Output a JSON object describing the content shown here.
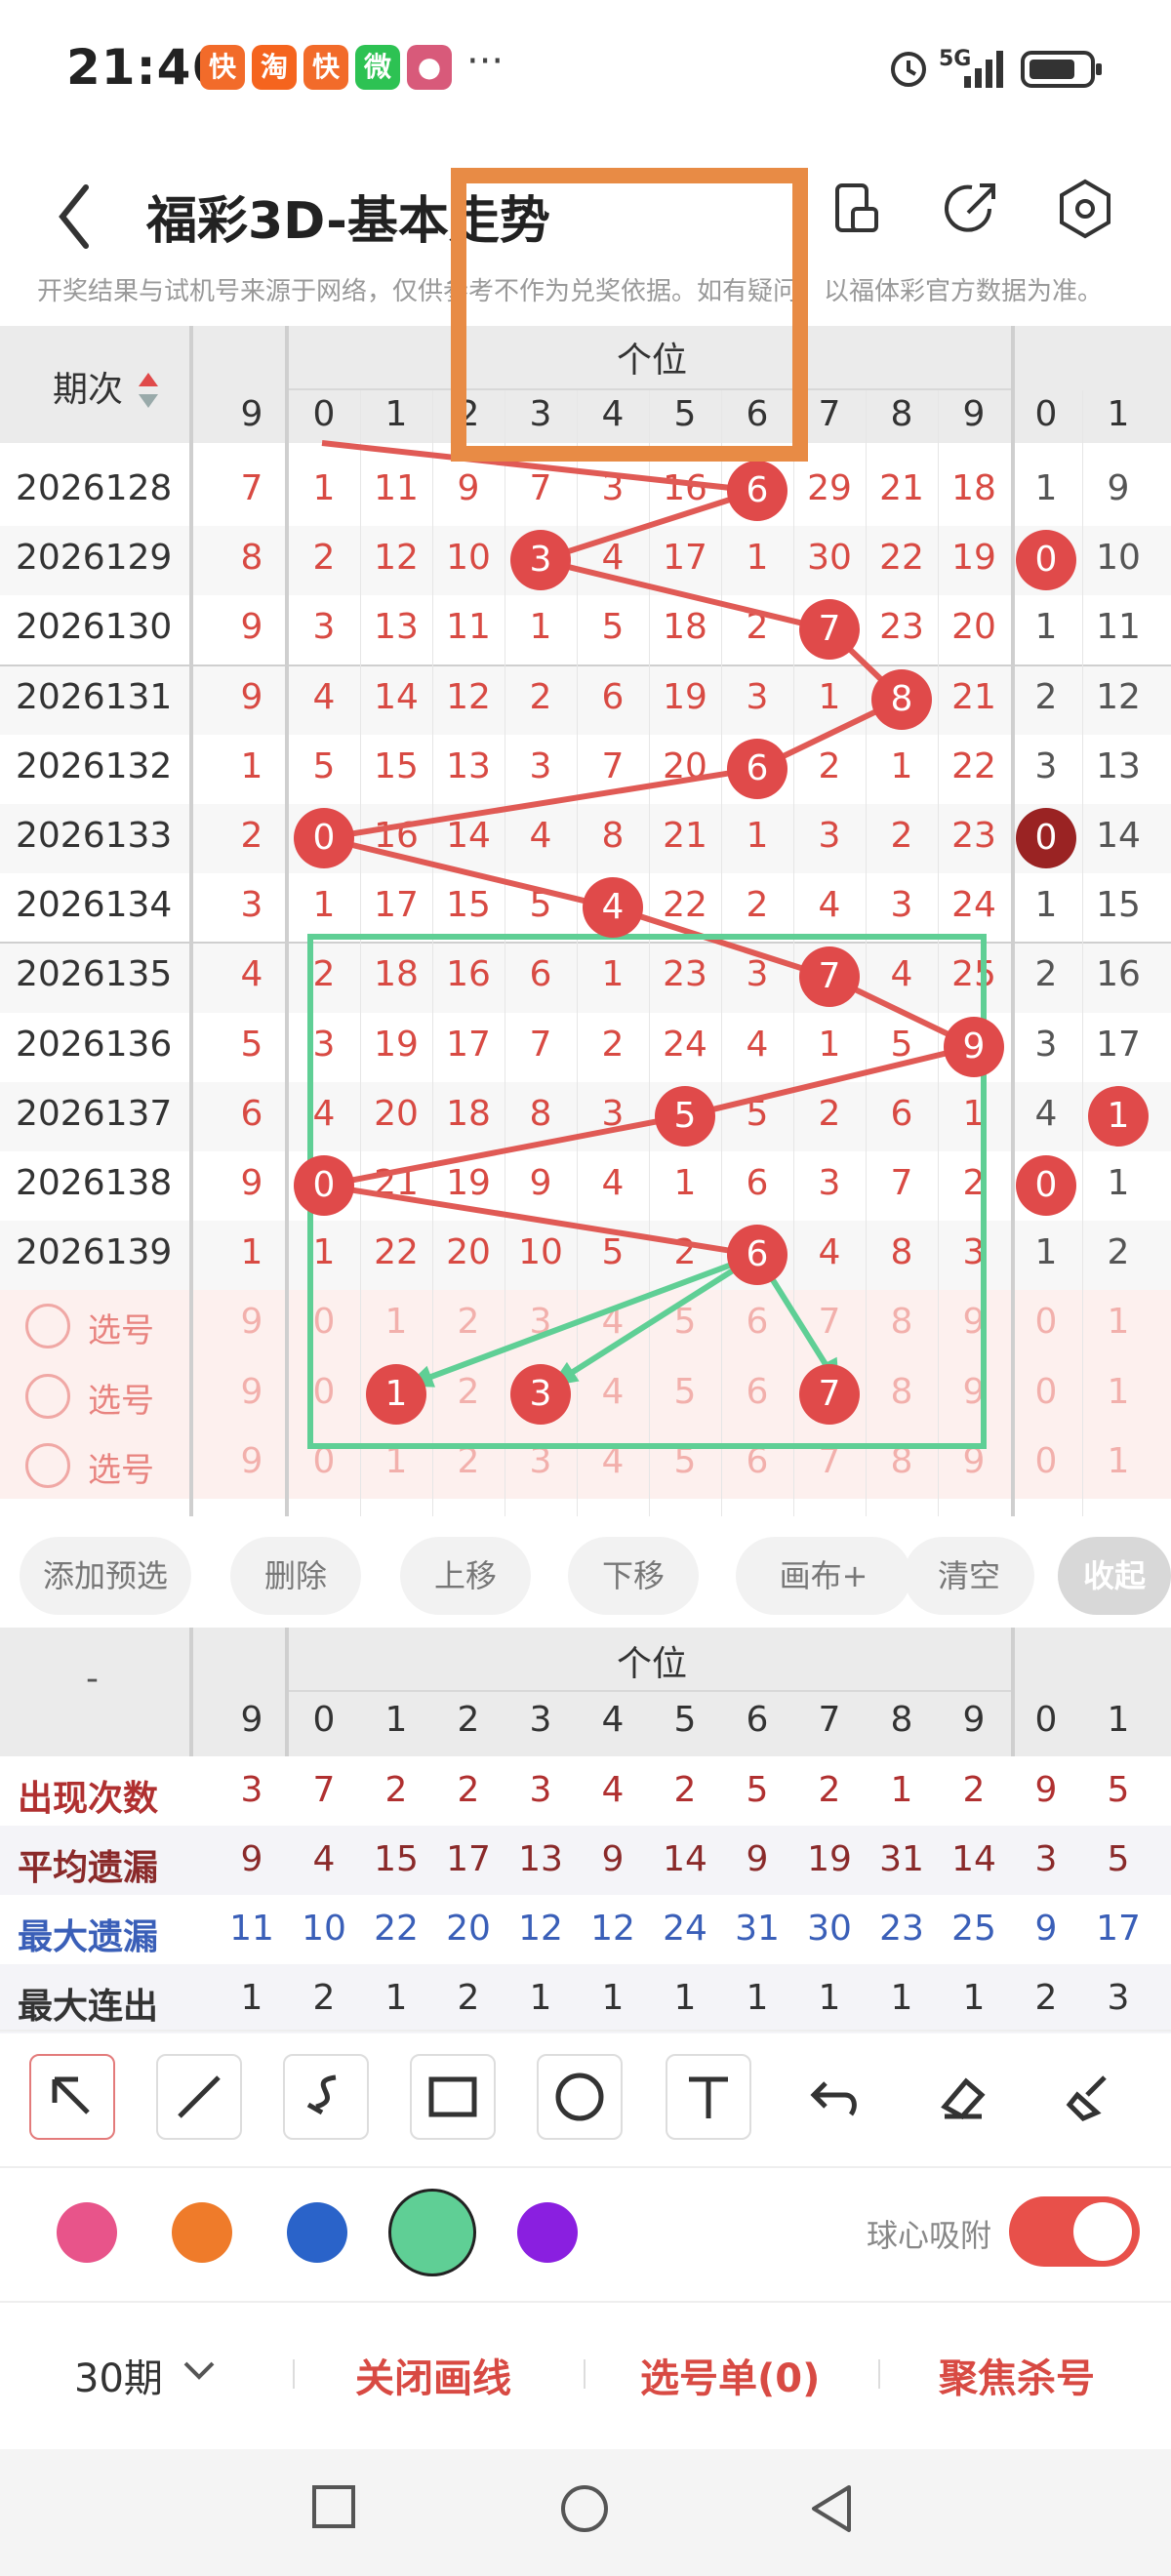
{
  "status_bar": {
    "time": "21:46",
    "apps": [
      {
        "icon": "kuaishou-icon",
        "color": "#f26b2a",
        "glyph": "快"
      },
      {
        "icon": "taobao-icon",
        "color": "#f5641e",
        "glyph": "淘"
      },
      {
        "icon": "kuaishou-icon-2",
        "color": "#f26b2a",
        "glyph": "快"
      },
      {
        "icon": "wechat-icon",
        "color": "#2dc253",
        "glyph": "微"
      },
      {
        "icon": "game-app-icon",
        "color": "#d85a7a",
        "glyph": "●"
      }
    ],
    "more": "···",
    "network": "5G"
  },
  "header": {
    "title": "福彩3D-基本走势",
    "notice": "开奖结果与试机号来源于网络，仅供参考不作为兑奖依据。如有疑问，以福体彩官方数据为准。"
  },
  "trend_table": {
    "period_header": "期次",
    "group_label": "个位",
    "columns": [
      "9",
      "0",
      "1",
      "2",
      "3",
      "4",
      "5",
      "6",
      "7",
      "8",
      "9",
      "0",
      "1"
    ],
    "rows": [
      {
        "period": "2026128",
        "cells": [
          "7",
          "1",
          "11",
          "9",
          "7",
          "3",
          "16",
          "6",
          "29",
          "21",
          "18",
          "1",
          "9"
        ],
        "ball_index": 7
      },
      {
        "period": "2026129",
        "cells": [
          "8",
          "2",
          "12",
          "10",
          "3",
          "4",
          "17",
          "1",
          "30",
          "22",
          "19",
          "0",
          "10"
        ],
        "ball_index": 4
      },
      {
        "period": "2026130",
        "cells": [
          "9",
          "3",
          "13",
          "11",
          "1",
          "5",
          "18",
          "2",
          "7",
          "23",
          "20",
          "1",
          "11"
        ],
        "ball_index": 8
      },
      {
        "period": "2026131",
        "cells": [
          "9",
          "4",
          "14",
          "12",
          "2",
          "6",
          "19",
          "3",
          "1",
          "8",
          "21",
          "2",
          "12"
        ],
        "ball_index": 9
      },
      {
        "period": "2026132",
        "cells": [
          "1",
          "5",
          "15",
          "13",
          "3",
          "7",
          "20",
          "6",
          "2",
          "1",
          "22",
          "3",
          "13"
        ],
        "ball_index": 7
      },
      {
        "period": "2026133",
        "cells": [
          "2",
          "0",
          "16",
          "14",
          "4",
          "8",
          "21",
          "1",
          "3",
          "2",
          "23",
          "0",
          "14"
        ],
        "ball_index": 1
      },
      {
        "period": "2026134",
        "cells": [
          "3",
          "1",
          "17",
          "15",
          "5",
          "4",
          "22",
          "2",
          "4",
          "3",
          "24",
          "1",
          "15"
        ],
        "ball_index": 5
      },
      {
        "period": "2026135",
        "cells": [
          "4",
          "2",
          "18",
          "16",
          "6",
          "1",
          "23",
          "3",
          "7",
          "4",
          "25",
          "2",
          "16"
        ],
        "ball_index": 8
      },
      {
        "period": "2026136",
        "cells": [
          "5",
          "3",
          "19",
          "17",
          "7",
          "2",
          "24",
          "4",
          "1",
          "5",
          "9",
          "3",
          "17"
        ],
        "ball_index": 10
      },
      {
        "period": "2026137",
        "cells": [
          "6",
          "4",
          "20",
          "18",
          "8",
          "3",
          "5",
          "5",
          "2",
          "6",
          "1",
          "4",
          "1"
        ],
        "ball_index": 6
      },
      {
        "period": "2026138",
        "cells": [
          "9",
          "0",
          "21",
          "19",
          "9",
          "4",
          "1",
          "6",
          "3",
          "7",
          "2",
          "0",
          "1"
        ],
        "ball_index": 1
      },
      {
        "period": "2026139",
        "cells": [
          "1",
          "1",
          "22",
          "20",
          "10",
          "5",
          "2",
          "6",
          "4",
          "8",
          "3",
          "1",
          "2"
        ],
        "ball_index": 7
      }
    ],
    "pick_rows": [
      {
        "label": "选号",
        "cells": [
          "9",
          "0",
          "1",
          "2",
          "3",
          "4",
          "5",
          "6",
          "7",
          "8",
          "9",
          "0",
          "1"
        ],
        "balls": []
      },
      {
        "label": "选号",
        "cells": [
          "9",
          "0",
          "1",
          "2",
          "3",
          "4",
          "5",
          "6",
          "7",
          "8",
          "9",
          "0",
          "1"
        ],
        "balls": [
          2,
          4,
          8
        ]
      },
      {
        "label": "选号",
        "cells": [
          "9",
          "0",
          "1",
          "2",
          "3",
          "4",
          "5",
          "6",
          "7",
          "8",
          "9",
          "0",
          "1"
        ],
        "balls": []
      }
    ]
  },
  "actions": [
    "添加预选",
    "删除",
    "上移",
    "下移",
    "画布+",
    "清空",
    "收起"
  ],
  "stats": {
    "corner": "-",
    "group_label": "个位",
    "columns": [
      "9",
      "0",
      "1",
      "2",
      "3",
      "4",
      "5",
      "6",
      "7",
      "8",
      "9",
      "0",
      "1"
    ],
    "rows": [
      {
        "label": "出现次数",
        "color": "#b03030",
        "values": [
          "3",
          "7",
          "2",
          "2",
          "3",
          "4",
          "2",
          "5",
          "2",
          "1",
          "2",
          "9",
          "5"
        ]
      },
      {
        "label": "平均遗漏",
        "color": "#8a2a2a",
        "values": [
          "9",
          "4",
          "15",
          "17",
          "13",
          "9",
          "14",
          "9",
          "19",
          "31",
          "14",
          "3",
          "5"
        ]
      },
      {
        "label": "最大遗漏",
        "color": "#3a5fb8",
        "values": [
          "11",
          "10",
          "22",
          "20",
          "12",
          "12",
          "24",
          "31",
          "30",
          "23",
          "25",
          "9",
          "17"
        ]
      },
      {
        "label": "最大连出",
        "color": "#333333",
        "values": [
          "1",
          "2",
          "1",
          "2",
          "1",
          "1",
          "1",
          "1",
          "1",
          "1",
          "1",
          "2",
          "3"
        ]
      }
    ]
  },
  "drawing_tools": [
    "select-arrow-icon",
    "line-icon",
    "curve-icon",
    "rectangle-icon",
    "circle-icon",
    "text-icon",
    "undo-icon",
    "eraser-icon",
    "clear-brush-icon"
  ],
  "colors": [
    "#e8548a",
    "#ef7b2a",
    "#2a63c9",
    "#5fcf95",
    "#8a1fe0"
  ],
  "snap_label": "球心吸附",
  "bottom_bar": {
    "periods": "30期",
    "close_lines": "关闭画线",
    "pick_list": "选号单(0)",
    "focus_kill": "聚焦杀号"
  }
}
